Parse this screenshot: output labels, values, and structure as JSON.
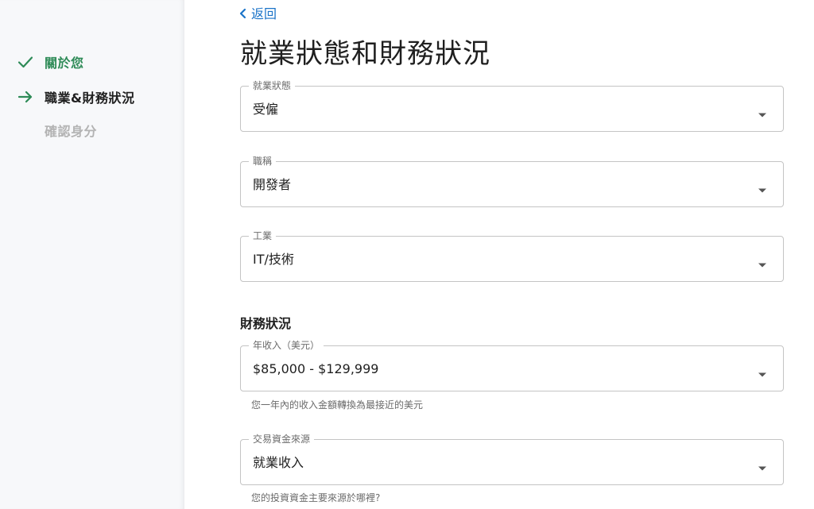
{
  "sidebar": {
    "steps": [
      {
        "label": "關於您",
        "state": "done"
      },
      {
        "label": "職業&財務狀況",
        "state": "current"
      },
      {
        "label": "確認身分",
        "state": "pending"
      }
    ]
  },
  "header": {
    "back_label": "返回",
    "title": "就業狀態和財務狀況"
  },
  "form": {
    "employment_status": {
      "label": "就業狀態",
      "value": "受僱"
    },
    "job_title": {
      "label": "職稱",
      "value": "開發者"
    },
    "industry": {
      "label": "工業",
      "value": "IT/技術"
    },
    "financial_section_title": "財務狀況",
    "annual_income": {
      "label": "年收入（美元）",
      "value": "$85,000 - $129,999",
      "helper": "您一年內的收入金額轉換為最接近的美元"
    },
    "funds_source": {
      "label": "交易資金來源",
      "value": "就業收入",
      "helper": "您的投資資金主要來源於哪裡?"
    }
  },
  "colors": {
    "accent_green": "#2e8b57",
    "link_blue": "#1a73c8",
    "border_gray": "#c4c4c4"
  }
}
